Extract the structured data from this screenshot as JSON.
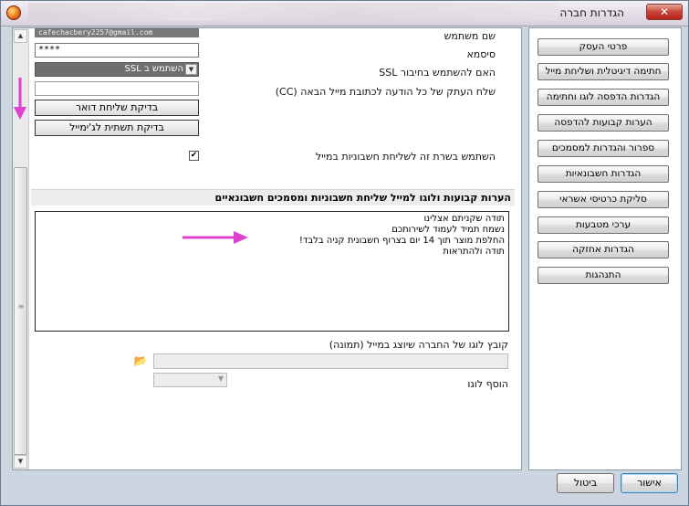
{
  "window": {
    "title": "הגדרות חברה",
    "close_label": "✕"
  },
  "settings": {
    "username_value": "cafechacbery2257@gmail.com",
    "username_label": "שם משתמש",
    "password_value": "****",
    "password_label": "סיסמא",
    "ssl_label": "האם להשתמש בחיבור SSL",
    "ssl_value": "השתמש ב SSL",
    "cc_label": "שלח העתק של כל הודעה לכתובת מייל הבאה (CC)",
    "cc_value": "",
    "check_mailer_button": "בדיקת שליחת דואר",
    "check_gmail_button": "בדיקת תשתית לג'ימייל",
    "use_server_label": "השתמש בשרת זה לשליחת חשבוניות במייל",
    "use_server_checked": true
  },
  "notes_section": {
    "title": "הערות קבועות ולוגו למייל שליחת חשבוניות ומסמכים חשבונאיים",
    "lines": [
      "תודה שקניתם אצלינו",
      "נשמח תמיד לעמוד לשירותכם",
      "החלפת מוצר תוך 14 יום בצרוף חשבונית קניה בלבד!",
      "תודה ולהתראות"
    ]
  },
  "logo": {
    "file_label": "קובץ לוגו של החברה שיוצג במייל (תמונה)",
    "add_logo_label": "הוסף לוגו"
  },
  "nav": {
    "items": [
      "פרטי העסק",
      "חתימה דיגיטלית ושליחת מייל",
      "הגדרות הדפסה לוגו וחתימה",
      "הערות קבועות להדפסה",
      "ספרור והגדרות למסמכים",
      "הגדרות חשבונאיות",
      "סליקת כרטיסי אשראי",
      "ערכי מטבעות",
      "הגדרות אחזקה",
      "התנהגות"
    ]
  },
  "dialog": {
    "ok_label": "אישור",
    "cancel_label": "ביטול"
  },
  "colors": {
    "annotation_arrow": "#e040d0",
    "frame_background": "#cdd6e0"
  }
}
